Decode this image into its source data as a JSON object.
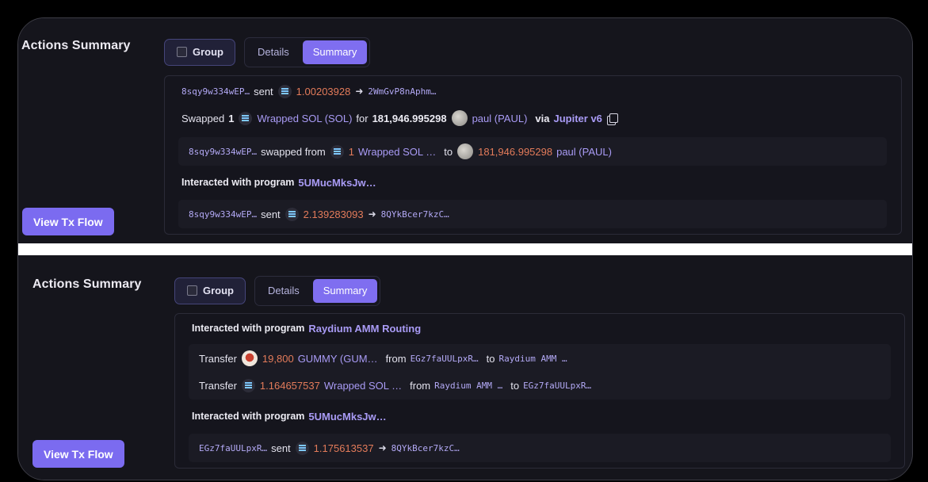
{
  "panel1": {
    "title": "Actions Summary",
    "group_label": "Group",
    "tab_details": "Details",
    "tab_summary": "Summary",
    "row1": {
      "from": "8sqy9w334wEP…",
      "verb": "sent",
      "amount": "1.00203928",
      "to": "2WmGvP8nAphm…"
    },
    "swap": {
      "label": "Swapped",
      "in_amount": "1",
      "in_token": "Wrapped SOL (SOL)",
      "for": "for",
      "out_amount": "181,946.995298",
      "out_token": "paul (PAUL)",
      "via": "via",
      "dex": "Jupiter v6"
    },
    "swap_detail": {
      "from": "8sqy9w334wEP…",
      "verb": "swapped from",
      "in_amount": "1",
      "in_token": "Wrapped SOL …",
      "to": "to",
      "out_amount": "181,946.995298",
      "out_token": "paul (PAUL)"
    },
    "interacted": {
      "label": "Interacted with program",
      "program": "5UMucMksJw…"
    },
    "row_last": {
      "from": "8sqy9w334wEP…",
      "verb": "sent",
      "amount": "2.139283093",
      "to": "8QYkBcer7kzC…"
    },
    "view_button": "View Tx Flow"
  },
  "panel2": {
    "title": "Actions Summary",
    "group_label": "Group",
    "tab_details": "Details",
    "tab_summary": "Summary",
    "interacted1": {
      "label": "Interacted with program",
      "program": "Raydium AMM Routing"
    },
    "transfer1": {
      "label": "Transfer",
      "amount": "19,800",
      "token": "GUMMY (GUM…",
      "from_label": "from",
      "from": "EGz7faUULpxR…",
      "to_label": "to",
      "to": "Raydium AMM …"
    },
    "transfer2": {
      "label": "Transfer",
      "amount": "1.164657537",
      "token": "Wrapped SOL …",
      "from_label": "from",
      "from": "Raydium AMM …",
      "to_label": "to",
      "to": "EGz7faUULpxR…"
    },
    "interacted2": {
      "label": "Interacted with program",
      "program": "5UMucMksJw…"
    },
    "row_last": {
      "from": "EGz7faUULpxR…",
      "verb": "sent",
      "amount": "1.175613537",
      "to": "8QYkBcer7kzC…"
    },
    "view_button": "View Tx Flow"
  },
  "icons": {
    "sol": "solana-icon",
    "paul": "paul-token-icon",
    "gummy": "gummy-token-icon",
    "arrow": "arrow-right-icon",
    "copy": "copy-icon"
  },
  "colors": {
    "accent": "#7f6ef0",
    "amount": "#e37b5a",
    "link": "#a99bf5",
    "address": "#b3a9f5"
  }
}
